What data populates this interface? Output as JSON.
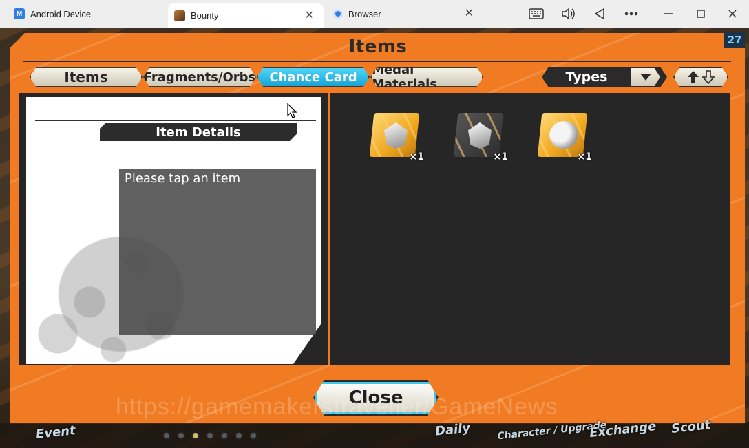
{
  "window": {
    "tabs": [
      {
        "label": "Android Device",
        "icon": "android-device-icon"
      },
      {
        "label": "Bounty",
        "icon": "bounty-game-icon"
      },
      {
        "label": "Browser",
        "icon": "browser-icon"
      }
    ],
    "controls": [
      "keyboard-icon",
      "volume-icon",
      "back-icon",
      "more-icon",
      "minimize-icon",
      "maximize-icon",
      "close-icon"
    ]
  },
  "game": {
    "title": "Items",
    "counter": "27",
    "categories": [
      {
        "label": "Items",
        "active": false
      },
      {
        "label": "Fragments/Orbs",
        "active": false
      },
      {
        "label": "Chance Card",
        "active": true
      },
      {
        "label": "Medal Materials",
        "active": false
      }
    ],
    "filter": {
      "label": "Types"
    },
    "detail": {
      "heading": "Item Details",
      "placeholder": "Please tap an item"
    },
    "items": [
      {
        "kind": "silver-gem-gold-card",
        "qty": "×1"
      },
      {
        "kind": "silver-gem-dark-card",
        "qty": "×1"
      },
      {
        "kind": "bounty-coin-gold-card",
        "qty": "×1"
      }
    ],
    "close_label": "Close",
    "watermark": "https://gamemakerstraveller/GameNews",
    "bottom_nav": [
      "Event",
      "Daily",
      "Character / Upgrade",
      "Exchange",
      "Scout"
    ],
    "page_dots": {
      "count": 7,
      "active_index": 2
    }
  },
  "colors": {
    "frame_orange": "#f07b23",
    "active_tab_blue": "#16a4d8",
    "panel_dark": "#262626"
  }
}
